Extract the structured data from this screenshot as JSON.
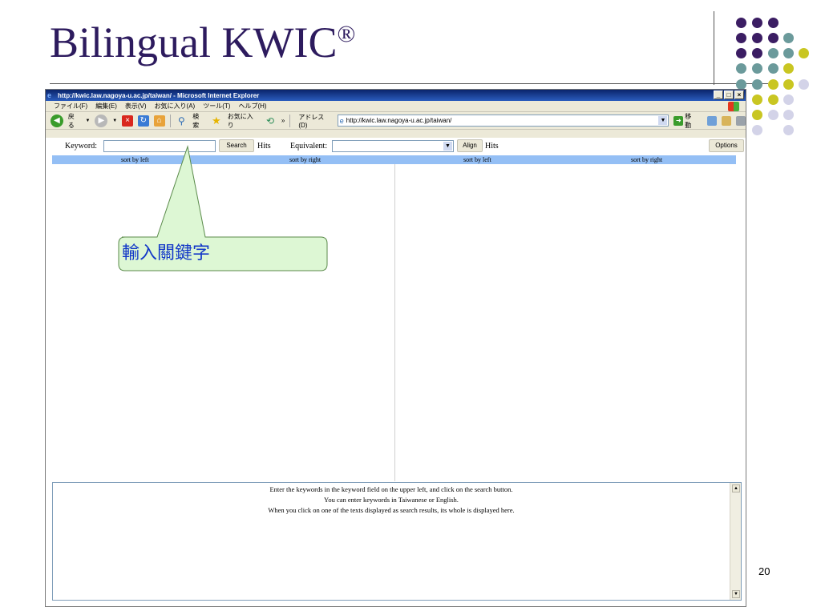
{
  "slide": {
    "title": "Bilingual KWIC",
    "title_mark": "®",
    "page_number": "20",
    "dot_colors": {
      "purple": "#3b1d63",
      "teal": "#6b9a9b",
      "yellow": "#c9c622",
      "lavender": "#d3d3e8"
    }
  },
  "browser": {
    "title": "http://kwic.law.nagoya-u.ac.jp/taiwan/ - Microsoft Internet Explorer",
    "window_buttons": [
      "_",
      "□",
      "×"
    ],
    "menu": [
      "ファイル(F)",
      "編集(E)",
      "表示(V)",
      "お気に入り(A)",
      "ツール(T)",
      "ヘルプ(H)"
    ],
    "toolbar": {
      "back": "戻る",
      "search": "検索",
      "favorites": "お気に入り",
      "more": "»",
      "address_label": "アドレス(D)",
      "address_value": "http://kwic.law.nagoya-u.ac.jp/taiwan/",
      "go": "移動"
    }
  },
  "page": {
    "keyword_label": "Keyword:",
    "keyword_value": "",
    "search_button": "Search",
    "hits_left": "Hits",
    "equivalent_label": "Equivalent:",
    "align_button": "Align",
    "hits_right": "Hits",
    "options_button": "Options",
    "sort_headers": [
      "sort by left",
      "sort by right",
      "sort by left",
      "sort by right"
    ],
    "instructions": [
      "Enter the keywords in the keyword field on the upper left, and click on the search button.",
      "You can enter keywords in Taiwanese or English.",
      "When you click on one of the texts displayed as search results, its whole is displayed here."
    ]
  },
  "callout": {
    "text": "輸入關鍵字",
    "fill": "#ddf7d4",
    "stroke": "#5a8a4a"
  }
}
